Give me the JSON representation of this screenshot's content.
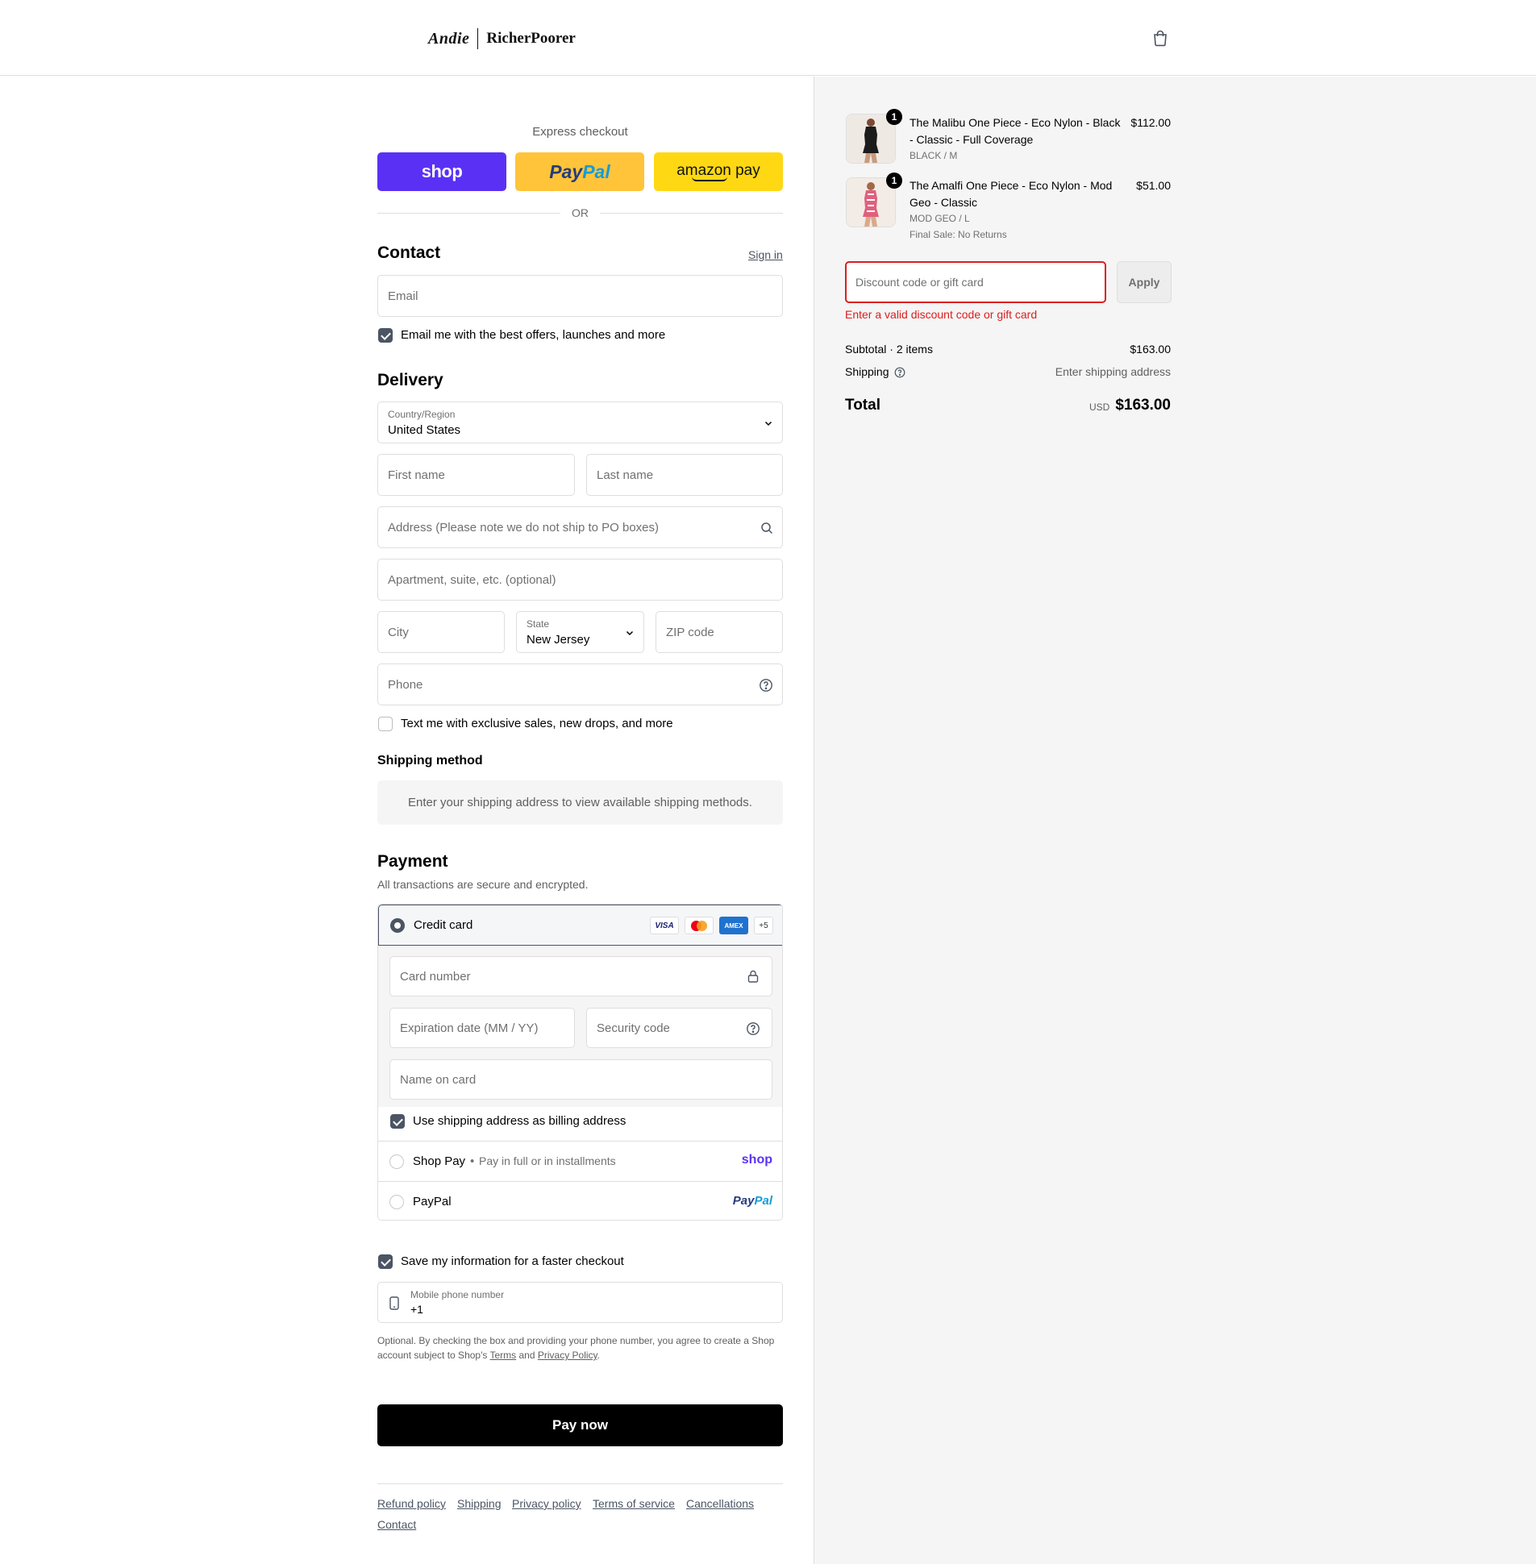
{
  "brand": {
    "left": "Andie",
    "right": "RicherPoorer"
  },
  "express": {
    "title": "Express checkout",
    "shop_label": "shop",
    "paypal_a": "Pay",
    "paypal_b": "Pal",
    "amazon_label": "amazon pay",
    "or": "OR"
  },
  "contact": {
    "heading": "Contact",
    "sign_in": "Sign in",
    "email_placeholder": "Email",
    "newsletter_label": "Email me with the best offers, launches and more"
  },
  "delivery": {
    "heading": "Delivery",
    "country_label": "Country/Region",
    "country_value": "United States",
    "first_name_placeholder": "First name",
    "last_name_placeholder": "Last name",
    "address_placeholder": "Address (Please note we do not ship to PO boxes)",
    "apartment_placeholder": "Apartment, suite, etc. (optional)",
    "city_placeholder": "City",
    "state_label": "State",
    "state_value": "New Jersey",
    "zip_placeholder": "ZIP code",
    "phone_placeholder": "Phone",
    "sms_label": "Text me with exclusive sales, new drops, and more"
  },
  "shipping_method": {
    "heading": "Shipping method",
    "notice": "Enter your shipping address to view available shipping methods."
  },
  "payment": {
    "heading": "Payment",
    "subtitle": "All transactions are secure and encrypted.",
    "credit_card_label": "Credit card",
    "card_badges": {
      "visa": "VISA",
      "amex": "AMEX",
      "more": "+5"
    },
    "card_number_placeholder": "Card number",
    "expiration_placeholder": "Expiration date (MM / YY)",
    "security_placeholder": "Security code",
    "name_placeholder": "Name on card",
    "billing_label": "Use shipping address as billing address",
    "shop_pay_label": "Shop Pay",
    "shop_pay_sub": "Pay in full or in installments",
    "shop_pay_logo": "shop",
    "paypal_label": "PayPal",
    "paypal_logo_a": "Pay",
    "paypal_logo_b": "Pal"
  },
  "remember": {
    "save_label": "Save my information for a faster checkout",
    "mobile_label": "Mobile phone number",
    "mobile_value": "+1",
    "legal_pre": "Optional. By checking the box and providing your phone number, you agree to create a Shop account subject to Shop's ",
    "terms": "Terms",
    "and": " and ",
    "privacy": "Privacy Policy",
    "end": "."
  },
  "pay_now": "Pay now",
  "footer": {
    "refund": "Refund policy",
    "shipping": "Shipping",
    "privacy": "Privacy policy",
    "terms": "Terms of service",
    "cancellations": "Cancellations",
    "contact": "Contact"
  },
  "cart": {
    "items": [
      {
        "qty": "1",
        "name": "The Malibu One Piece - Eco Nylon - Black - Classic - Full Coverage",
        "variant": "BLACK / M",
        "price": "$112.00",
        "swatch": "#1c1c1c"
      },
      {
        "qty": "1",
        "name": "The Amalfi One Piece - Eco Nylon - Mod Geo - Classic",
        "variant": "MOD GEO / L",
        "note": "Final Sale: No Returns",
        "price": "$51.00",
        "swatch": "#e0607e"
      }
    ],
    "discount_placeholder": "Discount code or gift card",
    "apply": "Apply",
    "error": "Enter a valid discount code or gift card",
    "subtotal_label": "Subtotal · 2 items",
    "subtotal_value": "$163.00",
    "shipping_label": "Shipping",
    "shipping_value": "Enter shipping address",
    "total_label": "Total",
    "currency": "USD",
    "total_value": "$163.00"
  },
  "colors": {
    "shop_purple": "#5a31f4",
    "paypal_yellow": "#ffc439",
    "amazon_yellow": "#ffd814",
    "error_red": "#dd1d1d",
    "accent": "#4b5563"
  }
}
